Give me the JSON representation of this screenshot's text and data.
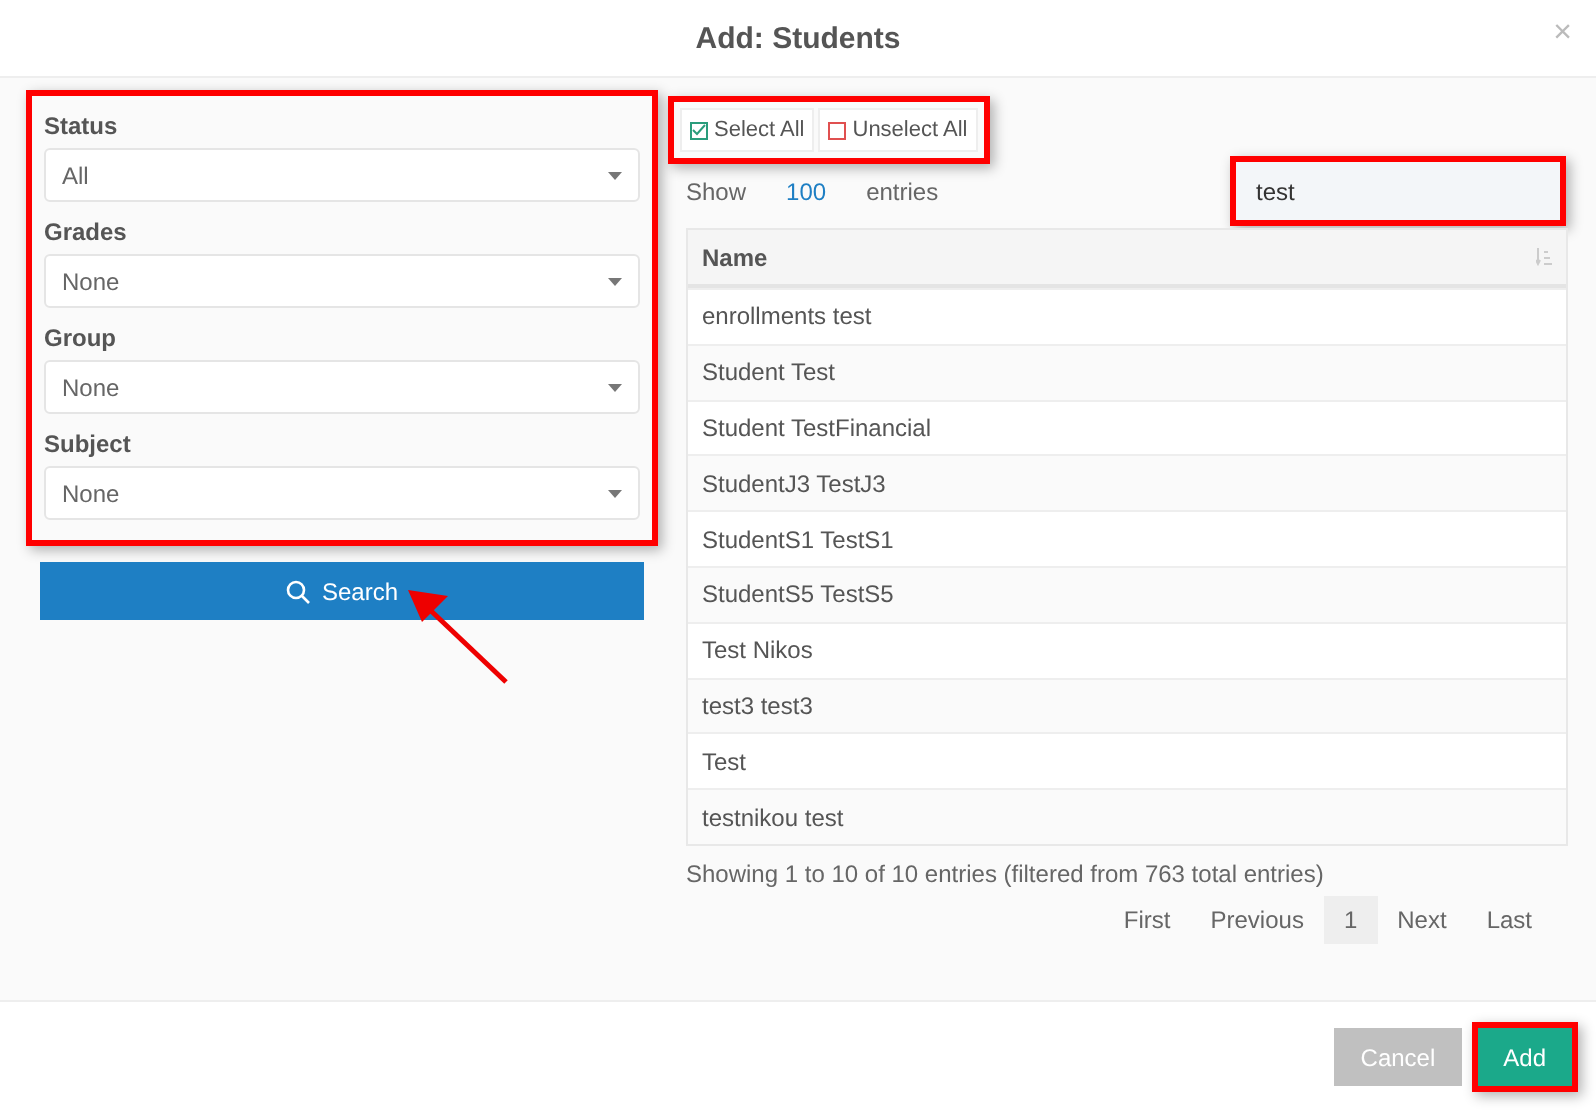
{
  "dialog": {
    "title": "Add: Students",
    "close": "×"
  },
  "filters": {
    "highlighted": true,
    "items": [
      {
        "label": "Status",
        "value": "All"
      },
      {
        "label": "Grades",
        "value": "None"
      },
      {
        "label": "Group",
        "value": "None"
      },
      {
        "label": "Subject",
        "value": "None"
      }
    ]
  },
  "search_button": {
    "label": "Search",
    "pointed_by_arrow": true
  },
  "selection_buttons": {
    "highlighted": true,
    "items": [
      {
        "kind": "select",
        "label": "Select All"
      },
      {
        "kind": "unselect",
        "label": "Unselect All"
      }
    ]
  },
  "length": {
    "before": "Show",
    "value": "100",
    "after": "entries"
  },
  "filter_field": {
    "value": "test",
    "highlighted": true
  },
  "table": {
    "columns": [
      "Name"
    ],
    "rows": [
      "enrollments test",
      "Student Test",
      "Student TestFinancial",
      "StudentJ3 TestJ3",
      "StudentS1 TestS1",
      "StudentS5 TestS5",
      "Test Nikos",
      "test3 test3",
      "Test",
      "testnikou test"
    ]
  },
  "info": "Showing 1 to 10 of 10 entries (filtered from 763 total entries)",
  "pagination": [
    {
      "label": "First",
      "selected": false
    },
    {
      "label": "Previous",
      "selected": false
    },
    {
      "label": "1",
      "selected": true
    },
    {
      "label": "Next",
      "selected": false
    },
    {
      "label": "Last",
      "selected": false
    }
  ],
  "footer": {
    "buttons": [
      {
        "kind": "cancel",
        "label": "Cancel",
        "highlighted": false
      },
      {
        "kind": "primary",
        "label": "Add",
        "highlighted": true
      }
    ]
  }
}
